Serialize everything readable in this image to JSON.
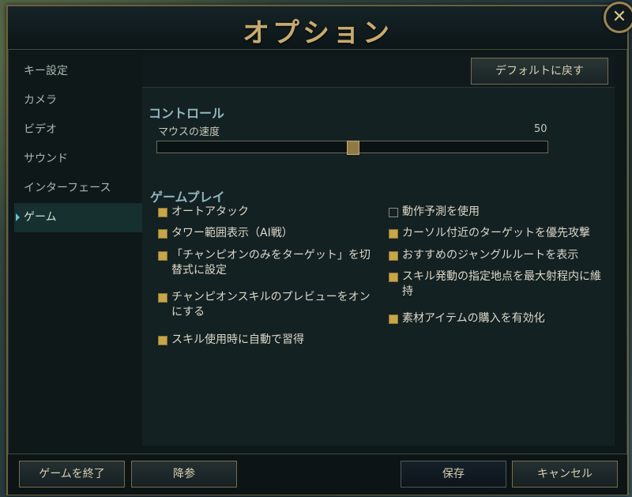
{
  "window": {
    "title": "オプション"
  },
  "sidebar": {
    "items": [
      {
        "label": "キー設定"
      },
      {
        "label": "カメラ"
      },
      {
        "label": "ビデオ"
      },
      {
        "label": "サウンド"
      },
      {
        "label": "インターフェース"
      },
      {
        "label": "ゲーム"
      }
    ],
    "active_label": "ゲーム"
  },
  "content": {
    "default_button": "デフォルトに戻す",
    "control_section": {
      "title": "コントロール",
      "mouse_speed_label": "マウスの速度",
      "mouse_speed_value": "50",
      "mouse_speed_fraction": 0.5
    },
    "gameplay_section": {
      "title": "ゲームプレイ",
      "left_options": [
        {
          "label": "オートアタック",
          "checked": true
        },
        {
          "label": "タワー範囲表示（AI戦）",
          "checked": true
        },
        {
          "label": "「チャンピオンのみをターゲット」を切替式に設定",
          "checked": true
        },
        {
          "label": "チャンピオンスキルのプレビューをオンにする",
          "checked": true
        },
        {
          "label": "スキル使用時に自動で習得",
          "checked": true
        }
      ],
      "right_options": [
        {
          "label": "動作予測を使用",
          "checked": false
        },
        {
          "label": "カーソル付近のターゲットを優先攻撃",
          "checked": true
        },
        {
          "label": "おすすめのジャングルルートを表示",
          "checked": true
        },
        {
          "label": "スキル発動の指定地点を最大射程内に維持",
          "checked": true
        },
        {
          "label": "素材アイテムの購入を有効化",
          "checked": true
        }
      ]
    }
  },
  "footer": {
    "quit_label": "ゲームを終了",
    "surrender_label": "降参",
    "save_label": "保存",
    "cancel_label": "キャンセル"
  },
  "colors": {
    "accent_gold": "#c8aa6e",
    "section_title": "#8fb7bd",
    "checkbox_on": "#c8a548"
  }
}
